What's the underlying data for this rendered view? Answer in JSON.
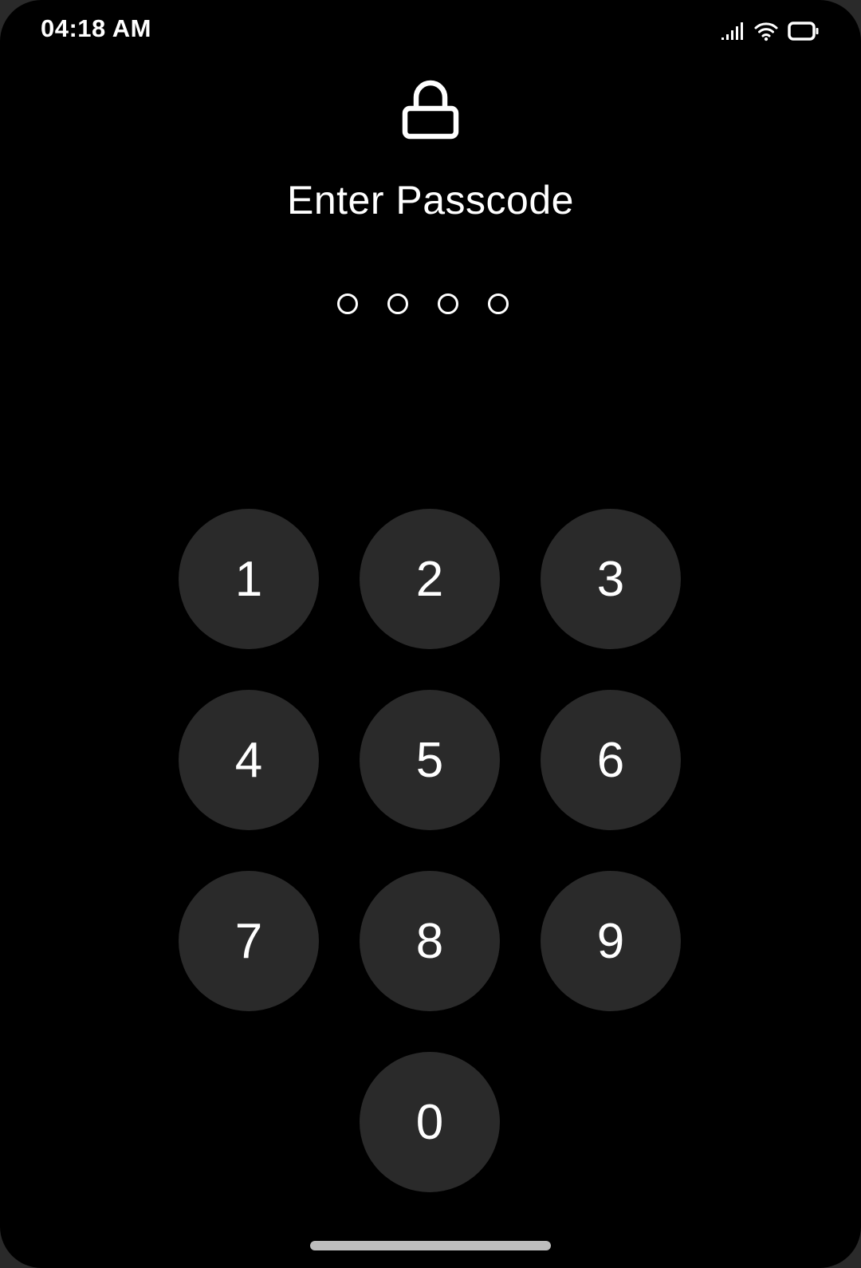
{
  "status_bar": {
    "time": "04:18 AM",
    "icons": [
      "signal-icon",
      "wifi-icon",
      "battery-icon"
    ]
  },
  "lock_screen": {
    "icon": "lock-icon",
    "title": "Enter Passcode",
    "passcode_length": 4,
    "entered_digits": 0
  },
  "keypad": {
    "keys": [
      "1",
      "2",
      "3",
      "4",
      "5",
      "6",
      "7",
      "8",
      "9",
      "0"
    ]
  },
  "colors": {
    "background": "#000000",
    "key_background": "#2a2a2a",
    "text": "#ffffff",
    "home_indicator": "#bdbdbd"
  }
}
